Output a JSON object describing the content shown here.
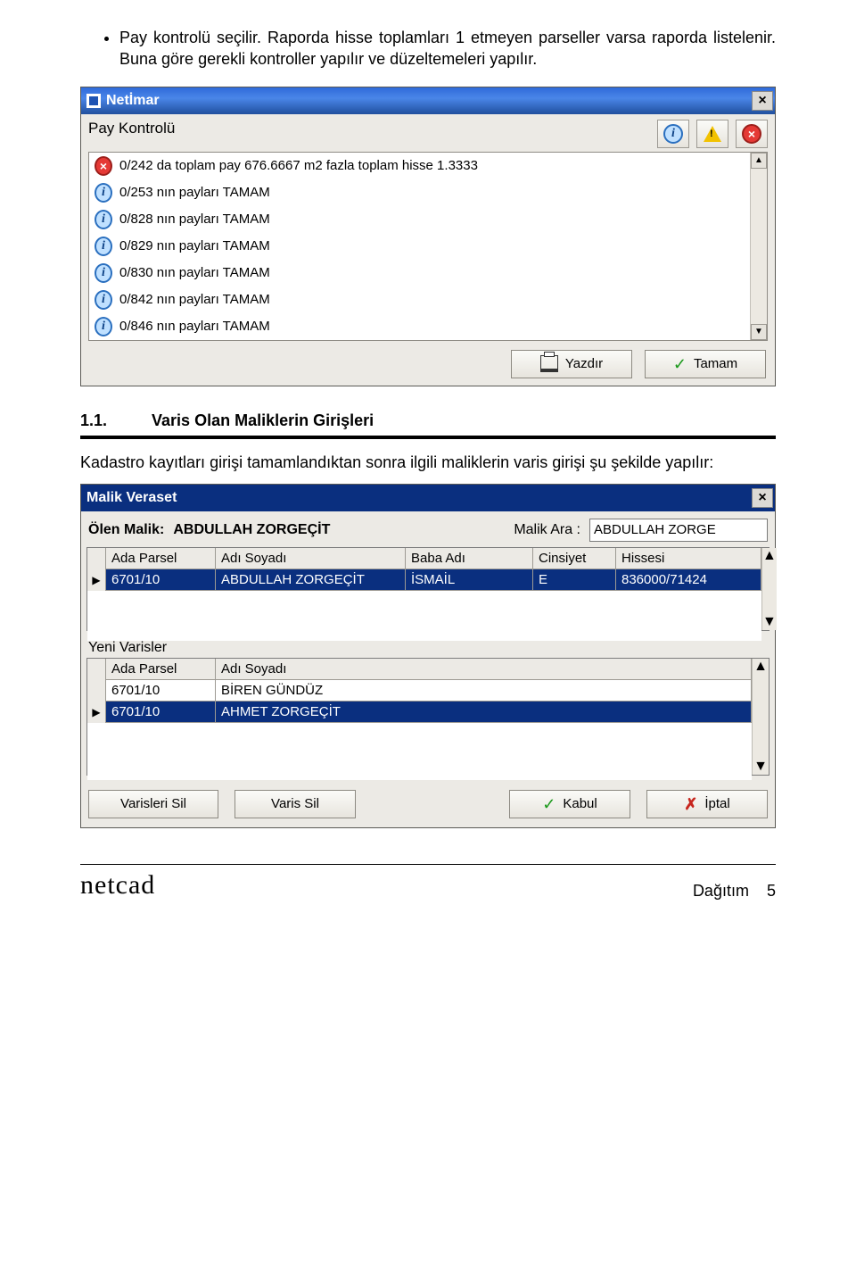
{
  "bullet_text": "Pay kontrolü seçilir. Raporda hisse toplamları 1 etmeyen parseller varsa raporda listelenir. Buna göre gerekli kontroller yapılır ve düzeltemeleri yapılır.",
  "netimar": {
    "title": "Netİmar",
    "section": "Pay Kontrolü",
    "rows": [
      {
        "icon": "err",
        "text": "0/242 da toplam pay   676.6667 m2 fazla  toplam hisse    1.3333"
      },
      {
        "icon": "info",
        "text": "0/253 nın payları TAMAM"
      },
      {
        "icon": "info",
        "text": "0/828 nın payları TAMAM"
      },
      {
        "icon": "info",
        "text": "0/829 nın payları TAMAM"
      },
      {
        "icon": "info",
        "text": "0/830 nın payları TAMAM"
      },
      {
        "icon": "info",
        "text": "0/842 nın payları TAMAM"
      },
      {
        "icon": "info",
        "text": "0/846 nın payları TAMAM"
      }
    ],
    "buttons": {
      "print": "Yazdır",
      "ok": "Tamam"
    }
  },
  "section": {
    "num": "1.1.",
    "title": "Varis Olan Maliklerin Girişleri",
    "para": "Kadastro kayıtları girişi tamamlandıktan sonra ilgili maliklerin varis girişi şu şekilde yapılır:"
  },
  "mv": {
    "title": "Malik Veraset",
    "olen_label": "Ölen Malik:",
    "olen_value": "ABDULLAH ZORGEÇİT",
    "ara_label": "Malik Ara :",
    "ara_value": "ABDULLAH ZORGE",
    "headers": {
      "ap": "Ada Parsel",
      "ad": "Adı Soyadı",
      "ba": "Baba Adı",
      "ci": "Cinsiyet",
      "hi": "Hissesi"
    },
    "top_rows": [
      {
        "selected": true,
        "ap": "6701/10",
        "ad": "ABDULLAH ZORGEÇİT",
        "ba": "İSMAİL",
        "ci": "E",
        "hi": "836000/71424"
      }
    ],
    "yeni_label": "Yeni Varisler",
    "bottom_rows": [
      {
        "selected": false,
        "ap": "6701/10",
        "ad": "BİREN GÜNDÜZ"
      },
      {
        "selected": true,
        "ap": "6701/10",
        "ad": "AHMET ZORGEÇİT"
      }
    ],
    "buttons": {
      "varisleri_sil": "Varisleri Sil",
      "varis_sil": "Varis Sil",
      "kabul": "Kabul",
      "iptal": "İptal"
    }
  },
  "footer": {
    "brand": "netcad",
    "doc": "Dağıtım",
    "page": "5"
  }
}
